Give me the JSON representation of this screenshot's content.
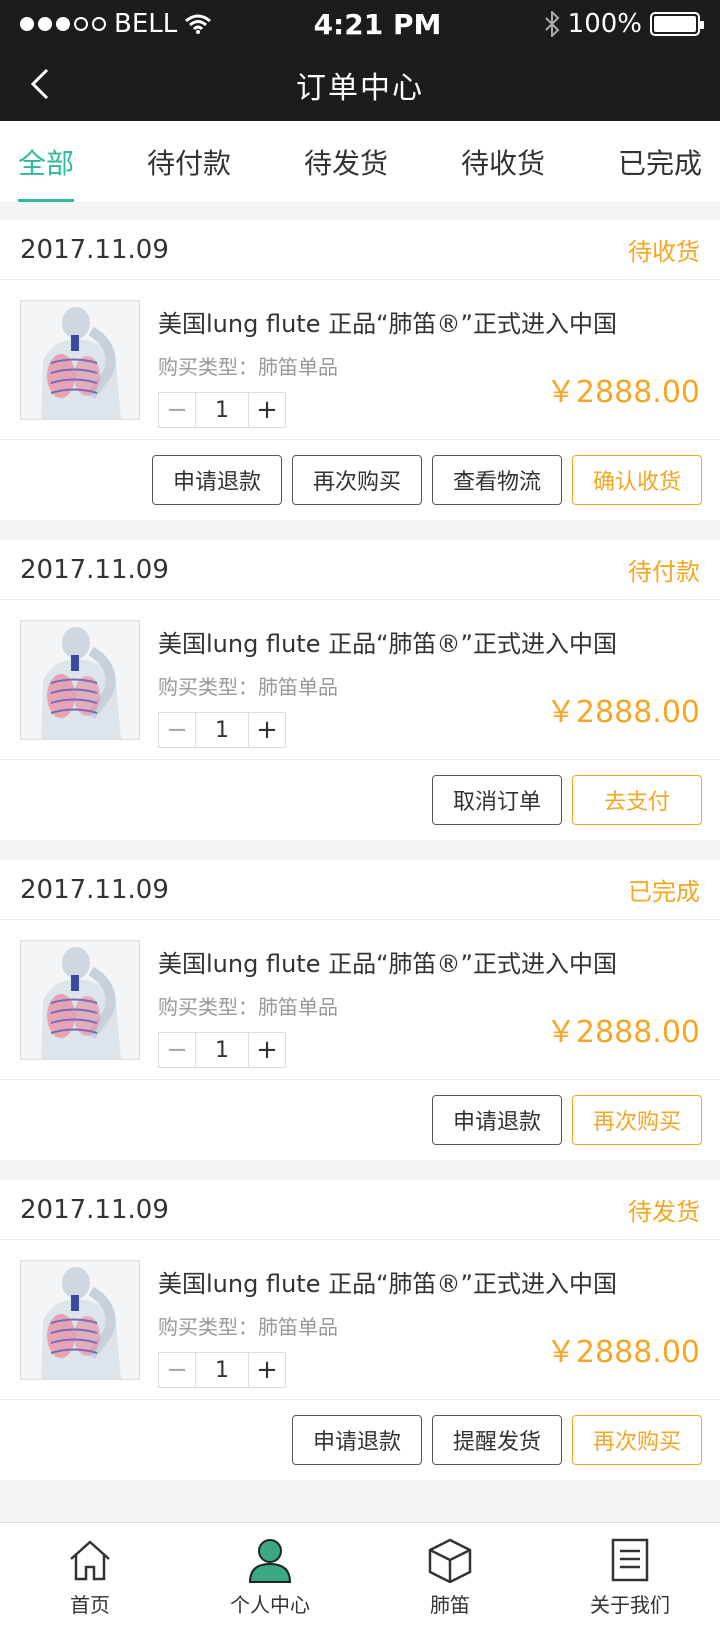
{
  "status_bar": {
    "carrier": "BELL",
    "time": "4:21 PM",
    "battery": "100%"
  },
  "nav": {
    "title": "订单中心"
  },
  "tabs": [
    "全部",
    "待付款",
    "待发货",
    "待收货",
    "已完成"
  ],
  "orders": [
    {
      "date": "2017.11.09",
      "status": "待收货",
      "product": "美国lung flute 正品“肺笛®”正式进入中国",
      "type": "购买类型：肺笛单品",
      "qty": "1",
      "price": "￥2888.00",
      "actions": [
        "申请退款",
        "再次购买",
        "查看物流",
        "确认收货"
      ]
    },
    {
      "date": "2017.11.09",
      "status": "待付款",
      "product": "美国lung flute 正品“肺笛®”正式进入中国",
      "type": "购买类型：肺笛单品",
      "qty": "1",
      "price": "￥2888.00",
      "actions": [
        "取消订单",
        "去支付"
      ]
    },
    {
      "date": "2017.11.09",
      "status": "已完成",
      "product": "美国lung flute 正品“肺笛®”正式进入中国",
      "type": "购买类型：肺笛单品",
      "qty": "1",
      "price": "￥2888.00",
      "actions": [
        "申请退款",
        "再次购买"
      ]
    },
    {
      "date": "2017.11.09",
      "status": "待发货",
      "product": "美国lung flute 正品“肺笛®”正式进入中国",
      "type": "购买类型：肺笛单品",
      "qty": "1",
      "price": "￥2888.00",
      "actions": [
        "申请退款",
        "提醒发货",
        "再次购买"
      ]
    }
  ],
  "tabbar": [
    {
      "label": "首页",
      "icon": "home-icon"
    },
    {
      "label": "个人中心",
      "icon": "person-icon"
    },
    {
      "label": "肺笛",
      "icon": "box-icon"
    },
    {
      "label": "关于我们",
      "icon": "document-icon"
    }
  ],
  "colors": {
    "accent": "#2dbb9a",
    "price": "#f5a623",
    "header": "#1c1c1e"
  }
}
